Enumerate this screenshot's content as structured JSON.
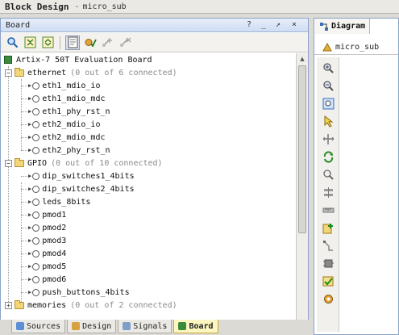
{
  "app": {
    "title": "Block Design",
    "separator": "-",
    "design_name": "micro_sub"
  },
  "board_panel": {
    "title": "Board",
    "controls": [
      "?",
      "_",
      "↗",
      "×"
    ],
    "toolbar": [
      "search-icon",
      "collapse-all-icon",
      "expand-all-icon",
      "board-view-icon",
      "auto-connect-icon",
      "add-connection-icon",
      "remove-connection-icon"
    ],
    "root": "Artix-7 50T Evaluation Board",
    "groups": {
      "ethernet": {
        "label": "ethernet",
        "summary": "(0 out of 6 connected)",
        "items": [
          "eth1_mdio_io",
          "eth1_mdio_mdc",
          "eth1_phy_rst_n",
          "eth2_mdio_io",
          "eth2_mdio_mdc",
          "eth2_phy_rst_n"
        ]
      },
      "gpio": {
        "label": "GPIO",
        "summary": "(0 out of 10 connected)",
        "items": [
          "dip_switches1_4bits",
          "dip_switches2_4bits",
          "leds_8bits",
          "pmod1",
          "pmod2",
          "pmod3",
          "pmod4",
          "pmod5",
          "pmod6",
          "push_buttons_4bits"
        ]
      },
      "memories": {
        "label": "memories",
        "summary": "(0 out of 2 connected)"
      }
    },
    "tabs": [
      "Sources",
      "Design",
      "Signals",
      "Board"
    ],
    "active_tab": "Board"
  },
  "diagram_panel": {
    "tab_label": "Diagram",
    "design_label": "micro_sub",
    "tools": [
      "zoom-in-icon",
      "zoom-out-icon",
      "zoom-fit-icon",
      "select-icon",
      "fit-selection-icon",
      "regenerate-layout-icon",
      "search-icon",
      "pin-icon",
      "ruler-icon",
      "add-ip-icon",
      "route-icon",
      "port-icon",
      "validate-icon",
      "settings-icon"
    ]
  },
  "colors": {
    "panel_header": "#cfdcf2",
    "active_tab": "#fdf6c0",
    "board_chip": "#3c8a3c",
    "folder": "#f2d67a"
  }
}
